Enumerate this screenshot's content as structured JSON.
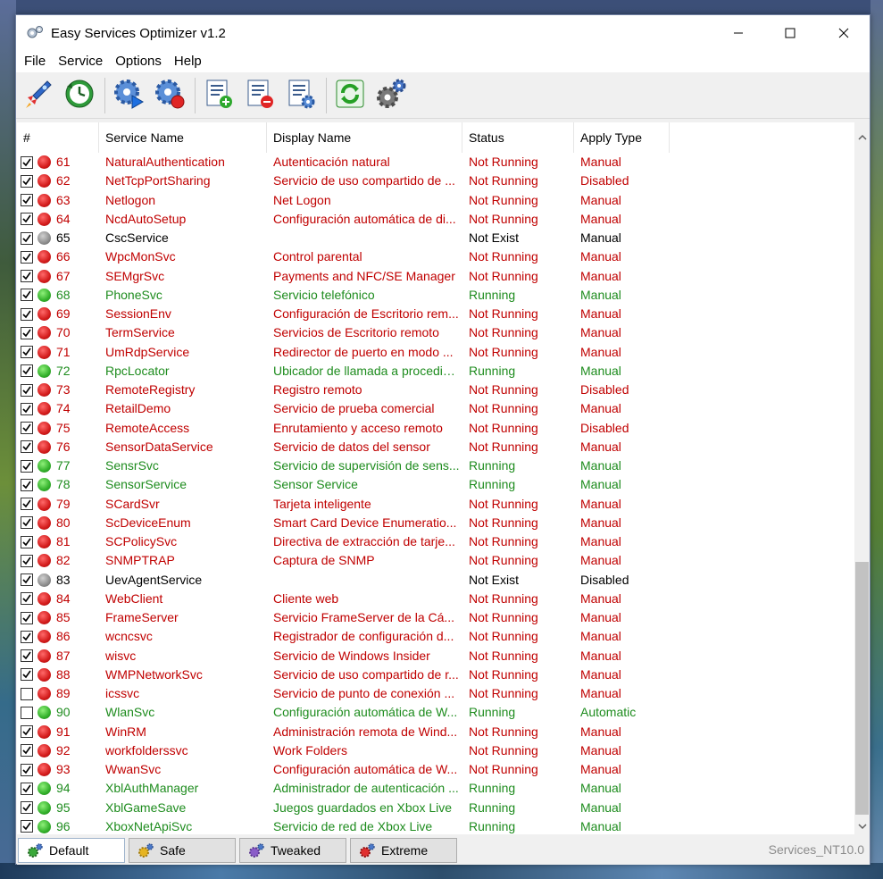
{
  "window": {
    "title": "Easy Services Optimizer v1.2"
  },
  "menu": [
    "File",
    "Service",
    "Options",
    "Help"
  ],
  "toolbar": {
    "buttons": [
      {
        "icon": "rocket-icon"
      },
      {
        "icon": "restore-clock-icon"
      },
      {
        "icon": "start-service-gear-icon"
      },
      {
        "icon": "stop-service-gear-icon"
      },
      {
        "icon": "add-list-icon"
      },
      {
        "icon": "remove-list-icon"
      },
      {
        "icon": "list-settings-icon"
      },
      {
        "icon": "refresh-icon"
      },
      {
        "icon": "settings-gears-icon"
      }
    ]
  },
  "columns": [
    "#",
    "Service Name",
    "Display Name",
    "Status",
    "Apply Type"
  ],
  "colors": {
    "red": "#c00000",
    "green": "#1e8c1e",
    "black": "#000000"
  },
  "rows": [
    {
      "checked": true,
      "state": "red",
      "num": "61",
      "service": "NaturalAuthentication",
      "display": "Autenticación natural",
      "status": "Not Running",
      "apply": "Manual"
    },
    {
      "checked": true,
      "state": "red",
      "num": "62",
      "service": "NetTcpPortSharing",
      "display": "Servicio de uso compartido de ...",
      "status": "Not Running",
      "apply": "Disabled"
    },
    {
      "checked": true,
      "state": "red",
      "num": "63",
      "service": "Netlogon",
      "display": "Net Logon",
      "status": "Not Running",
      "apply": "Manual"
    },
    {
      "checked": true,
      "state": "red",
      "num": "64",
      "service": "NcdAutoSetup",
      "display": "Configuración automática de di...",
      "status": "Not Running",
      "apply": "Manual"
    },
    {
      "checked": true,
      "state": "gray",
      "num": "65",
      "service": "CscService",
      "display": "",
      "status": "Not Exist",
      "apply": "Manual"
    },
    {
      "checked": true,
      "state": "red",
      "num": "66",
      "service": "WpcMonSvc",
      "display": "Control parental",
      "status": "Not Running",
      "apply": "Manual"
    },
    {
      "checked": true,
      "state": "red",
      "num": "67",
      "service": "SEMgrSvc",
      "display": "Payments and NFC/SE Manager",
      "status": "Not Running",
      "apply": "Manual"
    },
    {
      "checked": true,
      "state": "green",
      "num": "68",
      "service": "PhoneSvc",
      "display": "Servicio telefónico",
      "status": "Running",
      "apply": "Manual"
    },
    {
      "checked": true,
      "state": "red",
      "num": "69",
      "service": "SessionEnv",
      "display": "Configuración de Escritorio rem...",
      "status": "Not Running",
      "apply": "Manual"
    },
    {
      "checked": true,
      "state": "red",
      "num": "70",
      "service": "TermService",
      "display": "Servicios de Escritorio remoto",
      "status": "Not Running",
      "apply": "Manual"
    },
    {
      "checked": true,
      "state": "red",
      "num": "71",
      "service": "UmRdpService",
      "display": "Redirector de puerto en modo ...",
      "status": "Not Running",
      "apply": "Manual"
    },
    {
      "checked": true,
      "state": "green",
      "num": "72",
      "service": "RpcLocator",
      "display": "Ubicador de llamada a procedim...",
      "status": "Running",
      "apply": "Manual"
    },
    {
      "checked": true,
      "state": "red",
      "num": "73",
      "service": "RemoteRegistry",
      "display": "Registro remoto",
      "status": "Not Running",
      "apply": "Disabled"
    },
    {
      "checked": true,
      "state": "red",
      "num": "74",
      "service": "RetailDemo",
      "display": "Servicio de prueba comercial",
      "status": "Not Running",
      "apply": "Manual"
    },
    {
      "checked": true,
      "state": "red",
      "num": "75",
      "service": "RemoteAccess",
      "display": "Enrutamiento y acceso remoto",
      "status": "Not Running",
      "apply": "Disabled"
    },
    {
      "checked": true,
      "state": "red",
      "num": "76",
      "service": "SensorDataService",
      "display": "Servicio de datos del sensor",
      "status": "Not Running",
      "apply": "Manual"
    },
    {
      "checked": true,
      "state": "green",
      "num": "77",
      "service": "SensrSvc",
      "display": "Servicio de supervisión de sens...",
      "status": "Running",
      "apply": "Manual"
    },
    {
      "checked": true,
      "state": "green",
      "num": "78",
      "service": "SensorService",
      "display": "Sensor Service",
      "status": "Running",
      "apply": "Manual"
    },
    {
      "checked": true,
      "state": "red",
      "num": "79",
      "service": "SCardSvr",
      "display": "Tarjeta inteligente",
      "status": "Not Running",
      "apply": "Manual"
    },
    {
      "checked": true,
      "state": "red",
      "num": "80",
      "service": "ScDeviceEnum",
      "display": "Smart Card Device Enumeratio...",
      "status": "Not Running",
      "apply": "Manual"
    },
    {
      "checked": true,
      "state": "red",
      "num": "81",
      "service": "SCPolicySvc",
      "display": "Directiva de extracción de tarje...",
      "status": "Not Running",
      "apply": "Manual"
    },
    {
      "checked": true,
      "state": "red",
      "num": "82",
      "service": "SNMPTRAP",
      "display": "Captura de SNMP",
      "status": "Not Running",
      "apply": "Manual"
    },
    {
      "checked": true,
      "state": "gray",
      "num": "83",
      "service": "UevAgentService",
      "display": "",
      "status": "Not Exist",
      "apply": "Disabled"
    },
    {
      "checked": true,
      "state": "red",
      "num": "84",
      "service": "WebClient",
      "display": "Cliente web",
      "status": "Not Running",
      "apply": "Manual"
    },
    {
      "checked": true,
      "state": "red",
      "num": "85",
      "service": "FrameServer",
      "display": "Servicio FrameServer de la Cá...",
      "status": "Not Running",
      "apply": "Manual"
    },
    {
      "checked": true,
      "state": "red",
      "num": "86",
      "service": "wcncsvc",
      "display": "Registrador de configuración d...",
      "status": "Not Running",
      "apply": "Manual"
    },
    {
      "checked": true,
      "state": "red",
      "num": "87",
      "service": "wisvc",
      "display": "Servicio de Windows Insider",
      "status": "Not Running",
      "apply": "Manual"
    },
    {
      "checked": true,
      "state": "red",
      "num": "88",
      "service": "WMPNetworkSvc",
      "display": "Servicio de uso compartido de r...",
      "status": "Not Running",
      "apply": "Manual"
    },
    {
      "checked": false,
      "state": "red",
      "num": "89",
      "service": "icssvc",
      "display": "Servicio de punto de conexión ...",
      "status": "Not Running",
      "apply": "Manual"
    },
    {
      "checked": false,
      "state": "green",
      "num": "90",
      "service": "WlanSvc",
      "display": "Configuración automática de W...",
      "status": "Running",
      "apply": "Automatic"
    },
    {
      "checked": true,
      "state": "red",
      "num": "91",
      "service": "WinRM",
      "display": "Administración remota de Wind...",
      "status": "Not Running",
      "apply": "Manual"
    },
    {
      "checked": true,
      "state": "red",
      "num": "92",
      "service": "workfolderssvc",
      "display": "Work Folders",
      "status": "Not Running",
      "apply": "Manual"
    },
    {
      "checked": true,
      "state": "red",
      "num": "93",
      "service": "WwanSvc",
      "display": "Configuración automática de W...",
      "status": "Not Running",
      "apply": "Manual"
    },
    {
      "checked": true,
      "state": "green",
      "num": "94",
      "service": "XblAuthManager",
      "display": "Administrador de autenticación ...",
      "status": "Running",
      "apply": "Manual"
    },
    {
      "checked": true,
      "state": "green",
      "num": "95",
      "service": "XblGameSave",
      "display": "Juegos guardados en Xbox Live",
      "status": "Running",
      "apply": "Manual"
    },
    {
      "checked": true,
      "state": "green",
      "num": "96",
      "service": "XboxNetApiSvc",
      "display": "Servicio de red de Xbox Live",
      "status": "Running",
      "apply": "Manual"
    }
  ],
  "presets": [
    {
      "label": "Default",
      "icon": "gear-green-icon",
      "active": true
    },
    {
      "label": "Safe",
      "icon": "gear-yellow-icon",
      "active": false
    },
    {
      "label": "Tweaked",
      "icon": "gear-purple-icon",
      "active": false
    },
    {
      "label": "Extreme",
      "icon": "gear-red-icon",
      "active": false
    }
  ],
  "status_text": "Services_NT10.0"
}
